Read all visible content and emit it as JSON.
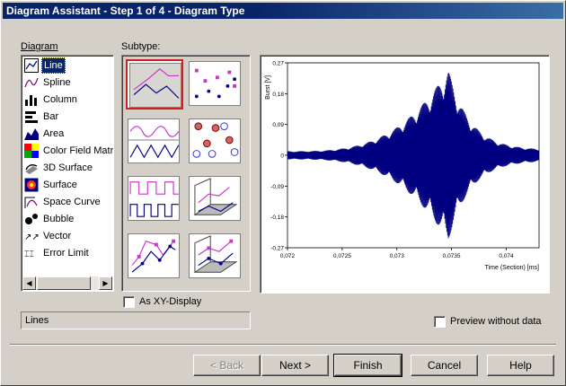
{
  "window": {
    "title": "Diagram Assistant - Step 1 of 4 - Diagram Type"
  },
  "diagram": {
    "label": "Diagram",
    "items": [
      {
        "label": "Line",
        "icon": "line-chart-icon",
        "selected": true
      },
      {
        "label": "Spline",
        "icon": "spline-chart-icon"
      },
      {
        "label": "Column",
        "icon": "column-chart-icon"
      },
      {
        "label": "Bar",
        "icon": "bar-chart-icon"
      },
      {
        "label": "Area",
        "icon": "area-chart-icon"
      },
      {
        "label": "Color Field Matrix",
        "icon": "color-field-icon"
      },
      {
        "label": "3D Surface",
        "icon": "3d-surface-icon"
      },
      {
        "label": "Surface",
        "icon": "surface-icon"
      },
      {
        "label": "Space Curve",
        "icon": "space-curve-icon"
      },
      {
        "label": "Bubble",
        "icon": "bubble-icon"
      },
      {
        "label": "Vector",
        "icon": "vector-icon"
      },
      {
        "label": "Error Limit",
        "icon": "error-limit-icon"
      }
    ]
  },
  "subtype": {
    "label": "Subtype:",
    "selected_index": 0
  },
  "xy_display": {
    "label": "As XY-Display",
    "checked": false
  },
  "status_text": "Lines",
  "preview_without_data": {
    "label": "Preview without data",
    "checked": false
  },
  "chart_data": {
    "type": "line",
    "ylabel": "Burst [V]",
    "xlabel": "Time (Section) [ms]",
    "y_ticks": [
      "0,27",
      "0,18",
      "0,09",
      "0",
      "-0,09",
      "-0,18",
      "-0,27"
    ],
    "x_ticks": [
      "0,072",
      "0,0725",
      "0,073",
      "0,0735",
      "0,074"
    ],
    "xlim": [
      0.072,
      0.0743
    ],
    "ylim": [
      -0.27,
      0.27
    ],
    "line_color": "#000080",
    "description_series": {
      "name": "",
      "envelope_peak_x": 0.07347,
      "envelope_peak_y": 0.25
    }
  },
  "buttons": {
    "back": "< Back",
    "next": "Next >",
    "finish": "Finish",
    "cancel": "Cancel",
    "help": "Help"
  }
}
